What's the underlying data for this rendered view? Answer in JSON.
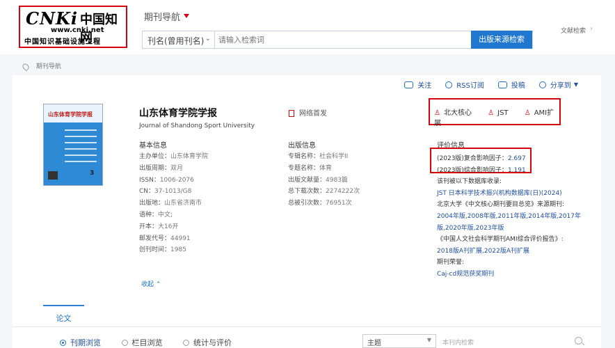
{
  "logo": {
    "brand": "CNKi",
    "cn_name": "中国知网",
    "url": "www.cnki.net",
    "subtitle": "中国知识基础设施工程"
  },
  "nav": {
    "title": "期刊导航"
  },
  "search": {
    "field": "刊名(曾用刊名)",
    "placeholder": "请输入检索词",
    "button": "出版来源检索",
    "advanced": "文献检索"
  },
  "breadcrumb": {
    "label": "期刊导航"
  },
  "actions": {
    "follow": "关注",
    "rss": "RSS订阅",
    "submit": "投稿",
    "share": "分享到"
  },
  "journal": {
    "cover_title": "山东体育学院学报",
    "cover_issue": "3",
    "title": "山东体育学院学报",
    "english": "Journal of Shandong Sport University",
    "net_first": "网络首发",
    "badges": [
      "北大核心",
      "JST",
      "AMI扩展"
    ]
  },
  "basic": {
    "title": "基本信息",
    "items": [
      {
        "k": "主办单位：",
        "v": "山东体育学院"
      },
      {
        "k": "出版周期：",
        "v": "双月"
      },
      {
        "k": "ISSN：",
        "v": "1006-2076"
      },
      {
        "k": "CN：",
        "v": "37-1013/G8"
      },
      {
        "k": "出版地：",
        "v": "山东省济南市"
      },
      {
        "k": "语种：",
        "v": "中文;"
      },
      {
        "k": "开本：",
        "v": "大16开"
      },
      {
        "k": "邮发代号：",
        "v": "44991"
      },
      {
        "k": "创刊时间：",
        "v": "1985"
      }
    ],
    "collapse": "收起"
  },
  "publish": {
    "title": "出版信息",
    "items": [
      {
        "k": "专辑名称：",
        "v": "社会科学II"
      },
      {
        "k": "专题名称：",
        "v": "体育"
      },
      {
        "k": "出版文献量：",
        "v": "4983篇"
      },
      {
        "k": "总下载次数：",
        "v": "2274222次"
      },
      {
        "k": "总被引次数：",
        "v": "76951次"
      }
    ]
  },
  "evaluation": {
    "title": "评价信息",
    "impact": [
      {
        "k": "(2023版)复合影响因子：",
        "v": "2.697"
      },
      {
        "k": "(2023版)综合影响因子：",
        "v": "1.191"
      }
    ],
    "lines": [
      "该刊被以下数据库收录:",
      "JST 日本科学技术振兴机构数据库(日)(2024)",
      "北京大学《中文核心期刊要目总览》来源期刊:",
      "2004年版,2008年版,2011年版,2014年版,2017年",
      "版,2020年版,2023年版",
      "《中国人文社会科学期刊AMI综合评价报告》:",
      "2018版A刊扩展,2022版A刊扩展",
      "期刊荣誉:",
      "Caj-cd规范获奖期刊"
    ]
  },
  "tabs": {
    "papers": "论文"
  },
  "browse": {
    "options": [
      "刊期浏览",
      "栏目浏览",
      "统计与评价"
    ],
    "selected": 0,
    "topic": "主题",
    "inner_search": "本刊内检索"
  }
}
